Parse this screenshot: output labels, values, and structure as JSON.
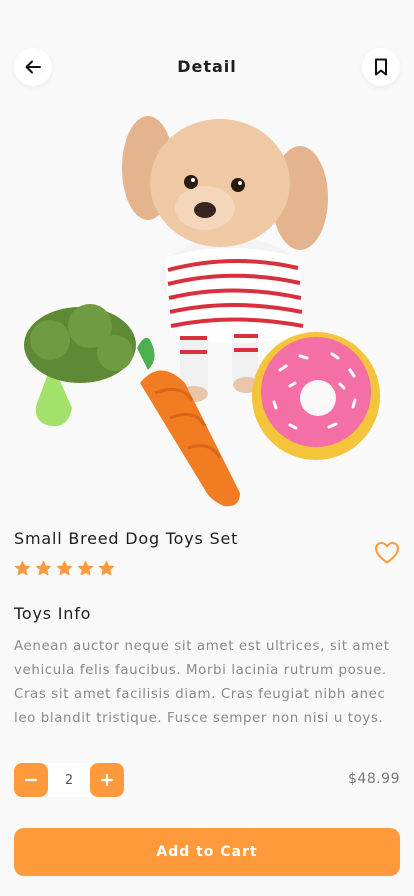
{
  "header": {
    "title": "Detail",
    "back_icon": "arrow-left-icon",
    "bookmark_icon": "bookmark-icon"
  },
  "product": {
    "name": "Small Breed Dog Toys Set",
    "rating": 5,
    "rating_max": 5,
    "image": "dog-with-toys-illustration"
  },
  "info": {
    "title": "Toys Info",
    "description": "Aenean auctor neque sit amet est ultrices, sit amet vehicula felis faucibus. Morbi lacinia rutrum posue. Cras sit amet facilisis diam. Cras feugiat nibh anec leo blandit tristique. Fusce semper non nisi u toys."
  },
  "order": {
    "quantity": "2",
    "price": "$48.99",
    "cta_label": "Add to Cart"
  },
  "colors": {
    "accent": "#ff9a3c",
    "background": "#f9f9f9",
    "text": "#1e1e1e",
    "muted": "#8a8a8a"
  }
}
